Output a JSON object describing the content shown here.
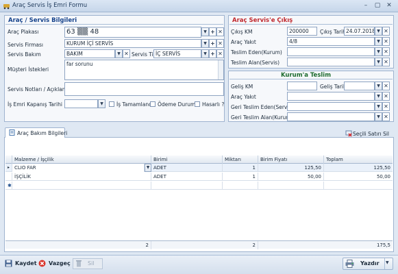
{
  "window": {
    "title": "Araç Servis İş Emri Formu",
    "minimize": "–",
    "maximize": "▢",
    "close": "✕"
  },
  "left_section": {
    "title": "Araç / Servis Bilgileri",
    "plate_label": "Araç Plakası",
    "plate_value": "63 ▒▒ 48",
    "firm_label": "Servis Firması",
    "firm_value": "KURUM İÇİ SERVİS",
    "bakim_label": "Servis Bakım",
    "bakim_value": "BAKIM",
    "tip_label": "Servis Tip",
    "tip_value": "İÇ SERVİS",
    "requests_label": "Müşteri İstekleri",
    "requests_value": "far sorunu",
    "notes_label": "Servis Notları / Açıklamalar",
    "notes_value": "",
    "close_date_label": "İş Emri Kapanış Tarihi",
    "close_date_value": "",
    "cb_done": "İş Tamamlandı",
    "cb_payment": "Ödeme Durumu",
    "cb_damage": "Hasarlı ?"
  },
  "right_top": {
    "title": "Araç Servis'e Çıkış",
    "km_label": "Çıkış KM",
    "km_value": "200000",
    "date_label": "Çıkış Tarihi",
    "date_value": "24.07.2018",
    "fuel_label": "Araç Yakıt",
    "fuel_value": "4/8",
    "delivered_label": "Teslim Eden(Kurum)",
    "delivered_value": "",
    "received_label": "Teslim Alan(Servis)",
    "received_value": ""
  },
  "right_bottom": {
    "title": "Kurum'a Teslim",
    "km_label": "Geliş KM",
    "km_value": "",
    "date_label": "Geliş Tarihi",
    "date_value": "",
    "fuel_label": "Araç Yakıt",
    "fuel_value": "",
    "return_delivered_label": "Geri Teslim Eden(Servis)",
    "return_delivered_value": "",
    "return_received_label": "Geri Teslim Alan(Kurum)",
    "return_received_value": ""
  },
  "tab": {
    "label": "Araç Bakım Bilgileri",
    "delete_row": "Seçili Satırı Sil"
  },
  "grid": {
    "columns": [
      "Malzeme / İşçilik",
      "Birimi",
      "Miktarı",
      "Birim Fiyatı",
      "Toplam"
    ],
    "rows": [
      [
        "CLIO FAR",
        "ADET",
        "1",
        "125,50",
        "125,50"
      ],
      [
        "İŞÇİLİK",
        "ADET",
        "1",
        "50,00",
        "50,00"
      ]
    ],
    "footer": {
      "count": "2",
      "qty": "2",
      "total": "175,5"
    },
    "row_marker": "▸",
    "new_marker": "✱"
  },
  "buttons": {
    "save": "Kaydet",
    "cancel": "Vazgeç",
    "delete": "Sil",
    "print": "Yazdır"
  }
}
